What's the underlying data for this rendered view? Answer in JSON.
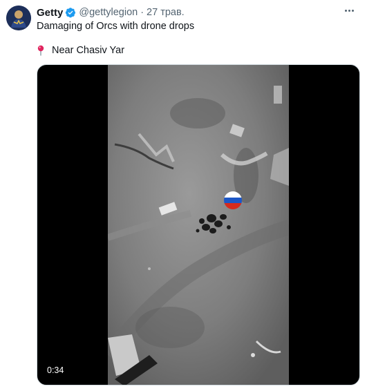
{
  "tweet": {
    "display_name": "Getty",
    "handle": "@gettylegion",
    "separator": "·",
    "date": "27 трав.",
    "text_line1": "Damaging of Orcs with drone drops",
    "location_text": "Near Chasiv Yar",
    "icons": {
      "verified": "verified-badge-icon",
      "location": "round-pushpin-icon",
      "more": "more-options-icon"
    },
    "colors": {
      "verified": "#1d9bf0",
      "handle": "#536471",
      "pin": "#e0245e"
    }
  },
  "media": {
    "duration": "0:34"
  }
}
